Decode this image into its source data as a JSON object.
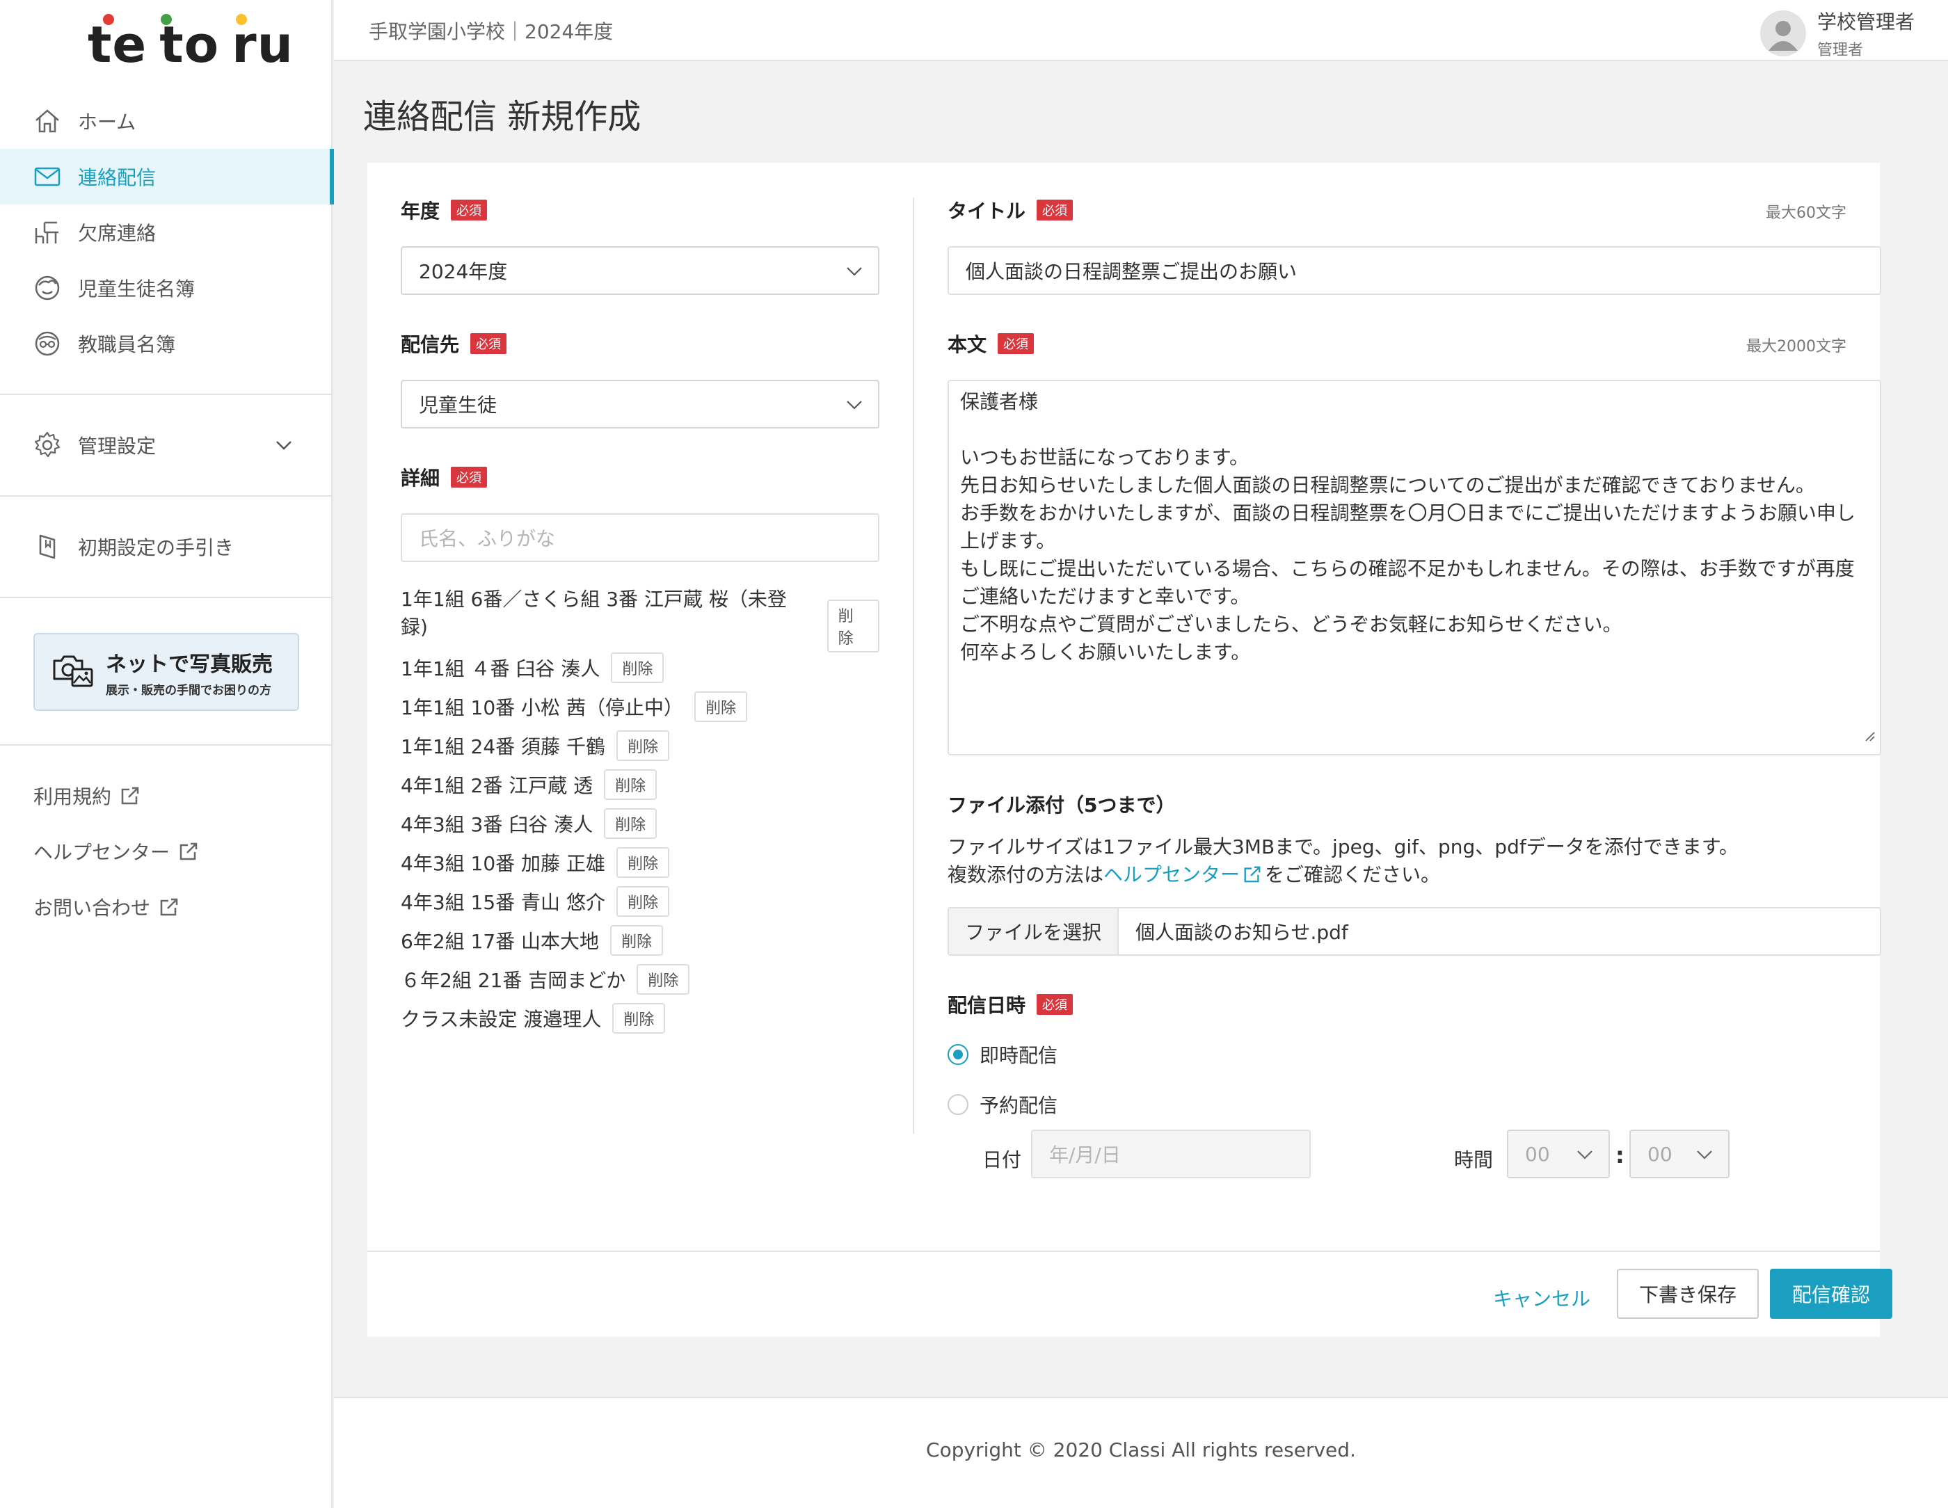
{
  "brand": {
    "logo_text": "tetoru",
    "logo_parts": [
      "te",
      "to",
      "ru"
    ],
    "dot_colors": [
      "#e53935",
      "#43a047",
      "#fbc02d"
    ]
  },
  "colors": {
    "accent": "#1a9fc0",
    "required": "#d9363e"
  },
  "sidebar": {
    "items": [
      {
        "label": "ホーム",
        "icon": "home-icon"
      },
      {
        "label": "連絡配信",
        "icon": "mail-icon",
        "active": true
      },
      {
        "label": "欠席連絡",
        "icon": "desk-icon"
      },
      {
        "label": "児童生徒名簿",
        "icon": "student-face-icon"
      },
      {
        "label": "教職員名簿",
        "icon": "teacher-face-icon"
      }
    ],
    "settings_label": "管理設定",
    "guide_label": "初期設定の手引き",
    "banner": {
      "title": "ネットで写真販売",
      "subtitle": "展示・販売の手間でお困りの方"
    },
    "links": [
      "利用規約",
      "ヘルプセンター",
      "お問い合わせ"
    ]
  },
  "header": {
    "school": "手取学園小学校｜2024年度",
    "user_name": "学校管理者",
    "user_role": "管理者"
  },
  "page_title": "連絡配信 新規作成",
  "form": {
    "required_badge": "必須",
    "year": {
      "label": "年度",
      "value": "2024年度"
    },
    "destination": {
      "label": "配信先",
      "value": "児童生徒"
    },
    "detail": {
      "label": "詳細",
      "placeholder": "氏名、ふりがな",
      "delete_label": "削除",
      "recipients": [
        "1年1組 6番／さくら組 3番 江戸蔵 桜（未登",
        "録)",
        "1年1組 ４番 臼谷 湊人",
        "1年1組 10番 小松 茜（停止中）",
        "1年1組 24番 須藤 千鶴",
        "4年1組 2番 江戸蔵 透",
        "4年3組 3番 臼谷 湊人",
        "4年3組 10番 加藤 正雄",
        "4年3組 15番 青山 悠介",
        "6年2組 17番 山本大地",
        "６年2組 21番 吉岡まどか",
        "クラス未設定 渡邉理人"
      ]
    },
    "title": {
      "label": "タイトル",
      "limit": "最大60文字",
      "value": "個人面談の日程調整票ご提出のお願い"
    },
    "body": {
      "label": "本文",
      "limit": "最大2000文字",
      "lines": [
        "保護者様",
        "",
        "いつもお世話になっております。",
        "先日お知らせいたしました個人面談の日程調整票についてのご提出がまだ確認できておりません。",
        "お手数をおかけいたしますが、面談の日程調整票を〇月〇日までにご提出いただけますようお願い申し",
        "上げます。",
        "もし既にご提出いただいている場合、こちらの確認不足かもしれません。その際は、お手数ですが再度",
        "ご連絡いただけますと幸いです。",
        "ご不明な点やご質問がございましたら、どうぞお気軽にお知らせください。",
        "何卒よろしくお願いいたします。"
      ]
    },
    "attachment": {
      "label": "ファイル添付（5つまで）",
      "desc1": "ファイルサイズは1ファイル最大3MBまで。jpeg、gif、png、pdfデータを添付できます。",
      "desc2_pre": "複数添付の方法は",
      "desc2_link": "ヘルプセンター",
      "desc2_post": "をご確認ください。",
      "button": "ファイルを選択",
      "file_name": "個人面談のお知らせ.pdf"
    },
    "schedule": {
      "label": "配信日時",
      "immediate": "即時配信",
      "scheduled": "予約配信",
      "selected": "即時配信",
      "date_label": "日付",
      "date_placeholder": "年/月/日",
      "time_label": "時間",
      "hour": "00",
      "minute": "00",
      "colon": ":"
    }
  },
  "actions": {
    "cancel": "キャンセル",
    "draft": "下書き保存",
    "confirm": "配信確認"
  },
  "footer": {
    "copyright": "Copyright © 2020 Classi All rights reserved."
  }
}
